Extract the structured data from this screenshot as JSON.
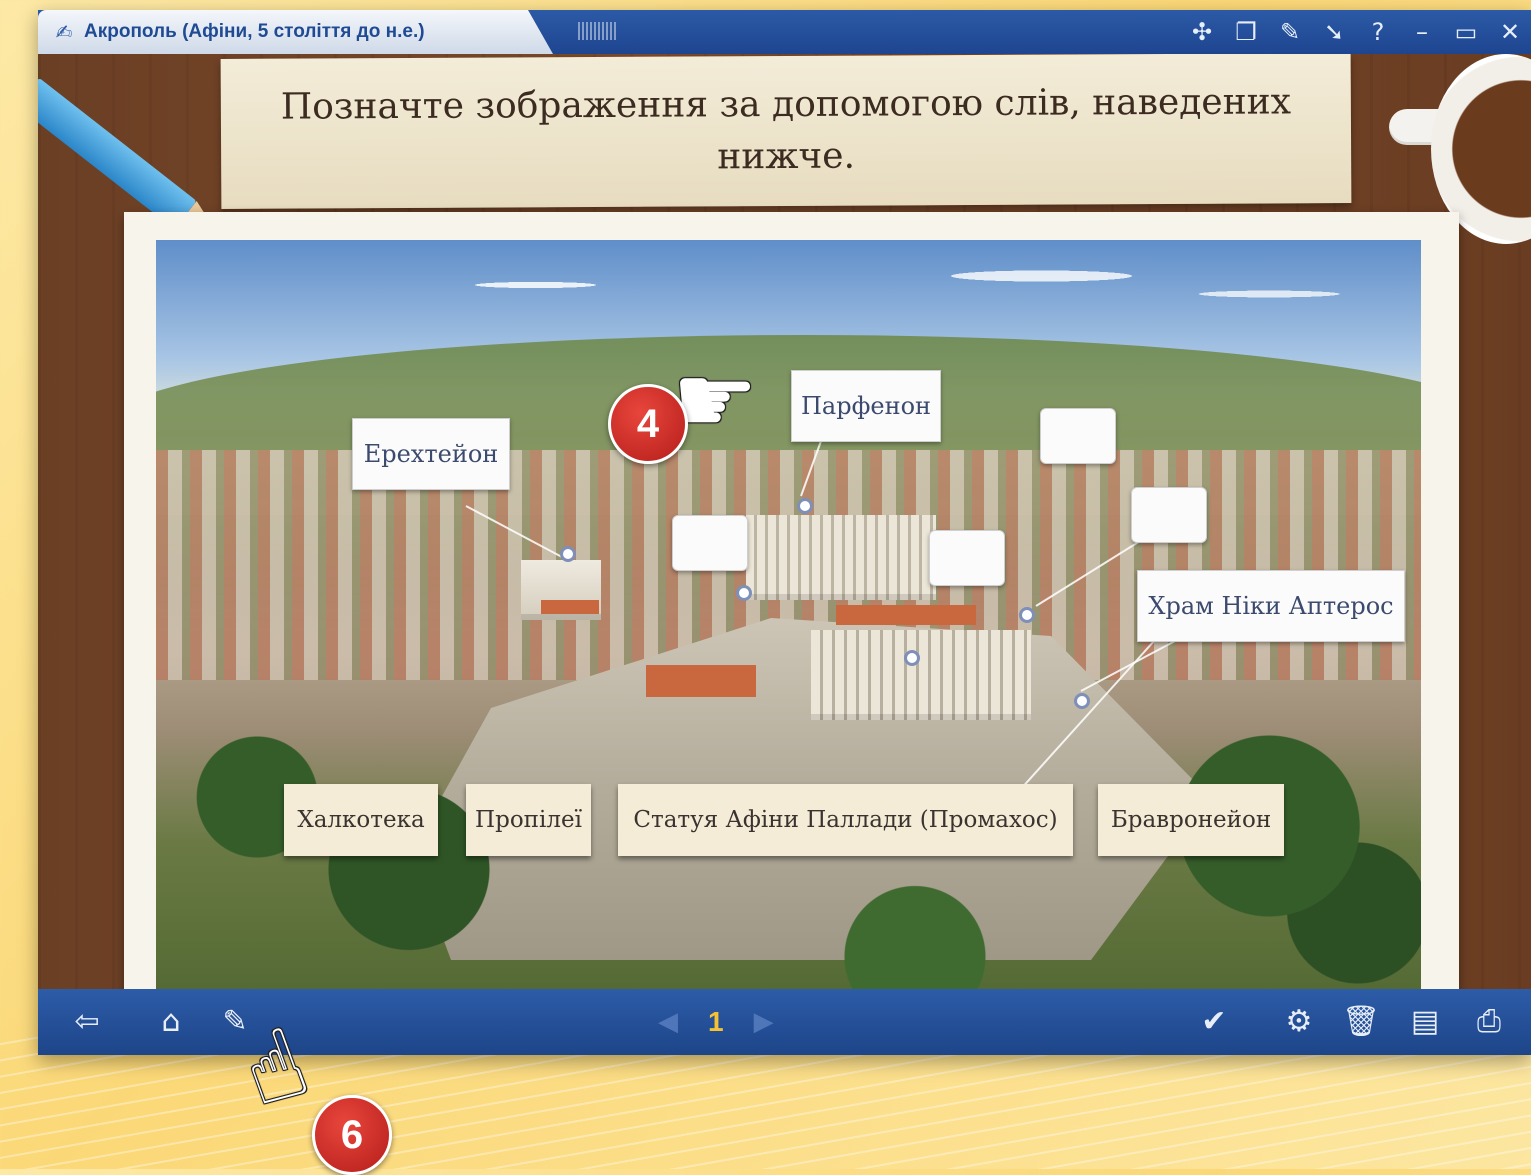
{
  "window": {
    "title": "Акрополь (Афіни, 5 століття до н.е.)",
    "title_icon": "edit-document-icon",
    "actions": [
      {
        "name": "network-icon",
        "glyph": "✣"
      },
      {
        "name": "windows-icon",
        "glyph": "❐"
      },
      {
        "name": "pen-icon",
        "glyph": "✎"
      },
      {
        "name": "pointer-icon",
        "glyph": "➘"
      },
      {
        "name": "help-icon",
        "glyph": "?"
      },
      {
        "name": "minimize-icon",
        "glyph": "–"
      },
      {
        "name": "maximize-icon",
        "glyph": "▭"
      },
      {
        "name": "close-icon",
        "glyph": "✕"
      }
    ]
  },
  "instruction": "Позначте зображення за допомогою слів, наведених нижче.",
  "placed_labels": {
    "erechtheion": "Ерехтейон",
    "parthenon": "Парфенон",
    "nike_temple": "Храм Ніки Аптерос"
  },
  "word_bank": [
    "Халкотека",
    "Пропілеї",
    "Статуя Афіни Паллади (Промахос)",
    "Бравронейон"
  ],
  "toolbar": {
    "left_icons": [
      {
        "name": "exit-icon",
        "glyph": "⇦"
      },
      {
        "name": "home-icon",
        "glyph": "⌂"
      },
      {
        "name": "edit-icon",
        "glyph": "✎"
      }
    ],
    "page": "1",
    "prev_glyph": "◀",
    "next_glyph": "▶",
    "right_icons": [
      {
        "name": "check-icon",
        "glyph": "✔"
      },
      {
        "name": "settings-icon",
        "glyph": "⚙"
      },
      {
        "name": "trash-icon",
        "glyph": "🗑"
      },
      {
        "name": "notes-icon",
        "glyph": "▤"
      },
      {
        "name": "save-icon",
        "glyph": "⎙"
      }
    ]
  },
  "callouts": {
    "badge_top": "4",
    "badge_bottom": "6"
  },
  "colors": {
    "titlebar": "#1e4590",
    "toolbar": "#2d5ca8",
    "badge": "#d2302a",
    "page_number": "#f4c233"
  }
}
